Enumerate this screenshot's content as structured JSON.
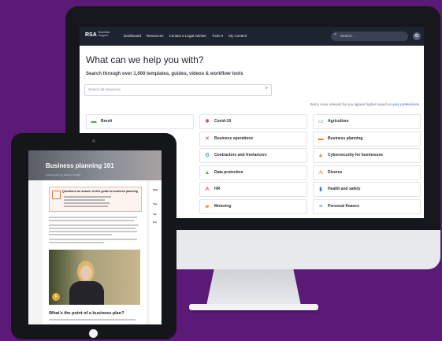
{
  "desktop": {
    "nav": {
      "logo": "RSA",
      "logo_sub": "Business Support",
      "links": [
        "Dashboard",
        "Resources",
        "Contact a Legal Adviser",
        "Tools ▾",
        "My Content"
      ],
      "search_placeholder": "Search..."
    },
    "heading": "What can we help you with?",
    "subheading": "Search through over 1,000 templates, guides, videos & workflow tools",
    "search_placeholder": "Search all resources",
    "preferences_text": "Items more relevant by you appear higher based on",
    "preferences_link": "your preferences",
    "categories": [
      {
        "label": "Brexit",
        "icon": "briefcase-icon",
        "color": "#4caf50"
      },
      {
        "label": "Covid-19",
        "icon": "virus-icon",
        "color": "#d6336c"
      },
      {
        "label": "Agriculture",
        "icon": "tractor-icon",
        "color": "#4caf50"
      },
      {
        "label": "Business operations",
        "icon": "tools-icon",
        "color": "#d6336c"
      },
      {
        "label": "Business planning",
        "icon": "briefcase-icon",
        "color": "#f0823a"
      },
      {
        "label": "Contractors and freelancers",
        "icon": "gear-icon",
        "color": "#3d7be0"
      },
      {
        "label": "Cybersecurity for businesses",
        "icon": "lock-icon",
        "color": "#f0823a"
      },
      {
        "label": "Data protection",
        "icon": "lock-icon",
        "color": "#4caf50"
      },
      {
        "label": "Divorce",
        "icon": "people-icon",
        "color": "#f0823a"
      },
      {
        "label": "HR",
        "icon": "people-icon",
        "color": "#d6336c"
      },
      {
        "label": "Health and safety",
        "icon": "clipboard-icon",
        "color": "#3d7be0"
      },
      {
        "label": "Motoring",
        "icon": "car-icon",
        "color": "#f0823a"
      },
      {
        "label": "Personal finance",
        "icon": "document-icon",
        "color": "#3d7be0"
      }
    ]
  },
  "tablet": {
    "title": "Business planning 101",
    "subtitle": "Created with our partners at RSA",
    "questions_title": "Questions we answer in this guide to business planning",
    "section_heading": "What’s the point of a business plan?",
    "side_texts": [
      "Wha",
      "The",
      "Tip",
      "Goi"
    ],
    "video_badge": "F"
  }
}
